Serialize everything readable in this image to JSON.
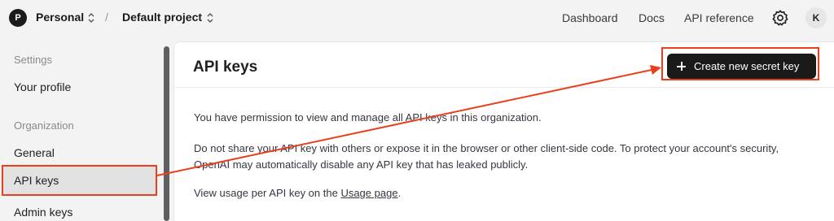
{
  "header": {
    "org_initial": "P",
    "org_name": "Personal",
    "separator": "/",
    "project_name": "Default project",
    "nav": [
      "Dashboard",
      "Docs",
      "API reference"
    ],
    "settings_icon": "gear-icon",
    "user_initial": "K"
  },
  "sidebar": {
    "section_settings": "Settings",
    "your_profile": "Your profile",
    "section_organization": "Organization",
    "general": "General",
    "api_keys": "API keys",
    "admin_keys": "Admin keys"
  },
  "main": {
    "title": "API keys",
    "create_button_label": "Create new secret key",
    "para1": "You have permission to view and manage all API keys in this organization.",
    "para2": "Do not share your API key with others or expose it in the browser or other client-side code. To protect your account's security, OpenAI may automatically disable any API key that has leaked publicly.",
    "para3_prefix": "View usage per API key on the ",
    "usage_link": "Usage page",
    "para3_suffix": "."
  },
  "colors": {
    "annotation": "#e8401c",
    "button_bg": "#1a1a1a",
    "active_item_bg": "#e2e2e2"
  }
}
